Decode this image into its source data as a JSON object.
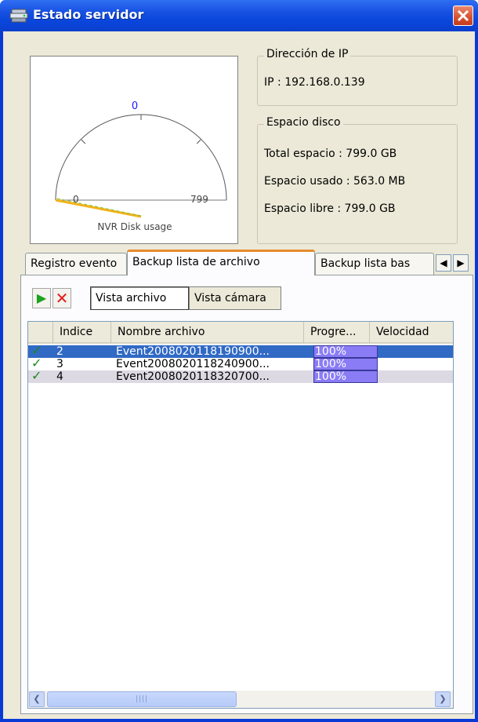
{
  "window": {
    "title": "Estado servidor"
  },
  "gauge": {
    "top_label": "0",
    "min_label": "0",
    "max_label": "799",
    "caption": "NVR Disk usage",
    "used_fraction": 0.0007
  },
  "ip_group": {
    "legend": "Dirección de IP",
    "ip": "IP : 192.168.0.139"
  },
  "disk_group": {
    "legend": "Espacio disco",
    "total": "Total espacio : 799.0 GB",
    "used": "Espacio usado : 563.0 MB",
    "free": "Espacio libre : 799.0 GB"
  },
  "tabs": [
    {
      "label": "Registro evento"
    },
    {
      "label": "Backup lista de archivo"
    },
    {
      "label": "Backup lista bas"
    }
  ],
  "toolbar": {
    "file_view": "Vista archivo",
    "camera_view": "Vista cámara"
  },
  "list": {
    "columns": [
      "",
      "Indice",
      "Nombre archivo",
      "Progre...",
      "Velocidad"
    ],
    "rows": [
      {
        "index": "2",
        "name": "Event2008020118190900...",
        "progress": "100%"
      },
      {
        "index": "3",
        "name": "Event2008020118240900...",
        "progress": "100%"
      },
      {
        "index": "4",
        "name": "Event2008020118320700...",
        "progress": "100%"
      }
    ]
  },
  "scrollbar": {
    "thumb_grip": "||||"
  }
}
